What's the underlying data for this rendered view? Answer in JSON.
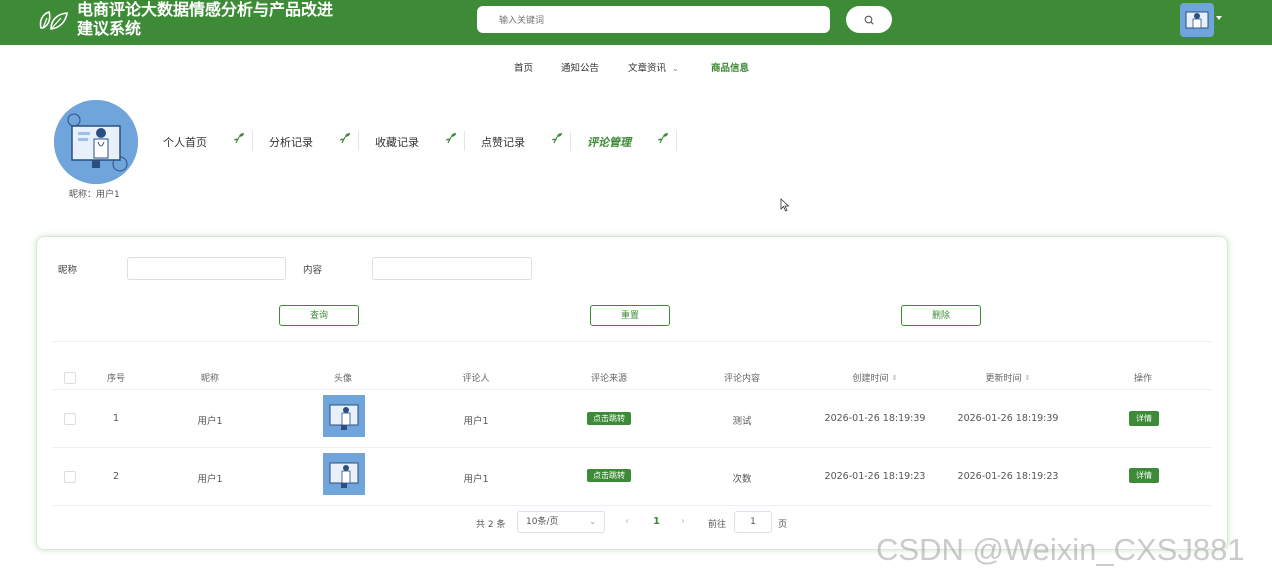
{
  "header": {
    "title": "电商评论大数据情感分析与产品改进建议系统",
    "search_placeholder": "输入关键词"
  },
  "nav": [
    {
      "label": "首页"
    },
    {
      "label": "通知公告"
    },
    {
      "label": "文章资讯"
    },
    {
      "label": "商品信息",
      "active": true
    }
  ],
  "profile": {
    "nickname": "昵称：用户1",
    "menu": [
      {
        "label": "个人首页"
      },
      {
        "label": "分析记录"
      },
      {
        "label": "收藏记录"
      },
      {
        "label": "点赞记录"
      },
      {
        "label": "评论管理",
        "active": true
      }
    ]
  },
  "filters": {
    "nickname_label": "昵称",
    "content_label": "内容"
  },
  "buttons": {
    "query": "查询",
    "reset": "重置",
    "delete": "删除"
  },
  "table": {
    "headers": [
      "序号",
      "昵称",
      "头像",
      "评论人",
      "评论来源",
      "评论内容",
      "创建时间",
      "更新时间",
      "操作"
    ],
    "rows": [
      {
        "index": "1",
        "nickname": "用户1",
        "commenter": "用户1",
        "source": "点击跳转",
        "content": "测试",
        "created": "2026-01-26 18:19:39",
        "updated": "2026-01-26 18:19:39",
        "action": "详情"
      },
      {
        "index": "2",
        "nickname": "用户1",
        "commenter": "用户1",
        "source": "点击跳转",
        "content": "次数",
        "created": "2026-01-26 18:19:23",
        "updated": "2026-01-26 18:19:23",
        "action": "详情"
      }
    ]
  },
  "pagination": {
    "total": "共 2 条",
    "page_size": "10条/页",
    "current": "1",
    "goto_label": "前往",
    "goto_value": "1",
    "page_suffix": "页"
  },
  "watermark": "CSDN @Weixin_CXSJ881",
  "colors": {
    "brand": "#3d8b37",
    "header_bg": "#3d8b37"
  }
}
